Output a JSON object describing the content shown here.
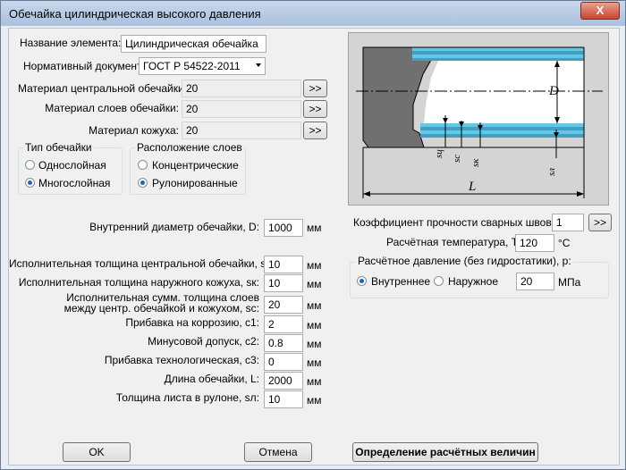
{
  "window": {
    "title": "Обечайка цилиндрическая высокого давления",
    "close_glyph": "X"
  },
  "element_name": {
    "label": "Название элемента:",
    "value": "Цилиндрическая обечайка"
  },
  "norm_doc": {
    "label": "Нормативный документ:",
    "value": "ГОСТ Р 54522-2011"
  },
  "materials": [
    {
      "label": "Материал центральной обечайки:",
      "value": "20",
      "button": ">>"
    },
    {
      "label": "Материал слоев обечайки:",
      "value": "20",
      "button": ">>"
    },
    {
      "label": "Материал кожуха:",
      "value": "20",
      "button": ">>"
    }
  ],
  "shell_type": {
    "title": "Тип обечайки",
    "options": [
      "Однослойная",
      "Многослойная"
    ],
    "selected": "Многослойная"
  },
  "layers_arrangement": {
    "title": "Расположение слоев",
    "options": [
      "Концентрические",
      "Рулонированные"
    ],
    "selected": "Рулонированные"
  },
  "inner_diameter": {
    "label": "Внутренний диаметр обечайки, D:",
    "value": "1000",
    "unit": "мм"
  },
  "params": [
    {
      "label": "Исполнительная толщина центральной обечайки, sц:",
      "value": "10",
      "unit": "мм"
    },
    {
      "label": "Исполнительная толщина наружного кожуха, sк:",
      "value": "10",
      "unit": "мм"
    },
    {
      "label_line1": "Исполнительная сумм. толщина слоев",
      "label_line2": "между центр. обечайкой и кожухом, sс:",
      "value": "20",
      "unit": "мм"
    },
    {
      "label": "Прибавка на коррозию, c1:",
      "value": "2",
      "unit": "мм"
    },
    {
      "label": "Минусовой допуск, c2:",
      "value": "0.8",
      "unit": "мм"
    },
    {
      "label": "Прибавка технологическая, c3:",
      "value": "0",
      "unit": "мм"
    },
    {
      "label": "Длина обечайки, L:",
      "value": "2000",
      "unit": "мм"
    },
    {
      "label": "Толщина листа в рулоне, sл:",
      "value": "10",
      "unit": "мм"
    }
  ],
  "weld": {
    "label": "Коэффициент прочности сварных швов, Fi:",
    "value": "1",
    "button": ">>"
  },
  "temperature": {
    "label": "Расчётная температура, T:",
    "value": "120",
    "unit": "°C"
  },
  "pressure": {
    "title": "Расчётное давление (без гидростатики), p:",
    "options": [
      "Внутреннее",
      "Наружное"
    ],
    "selected": "Внутреннее",
    "value": "20",
    "unit": "МПа"
  },
  "drawing_labels": {
    "D": "D",
    "L": "L",
    "s_c": "sц",
    "s_s": "sс",
    "s_k": "sк",
    "s_l": "sл"
  },
  "buttons": {
    "ok": "OK",
    "cancel": "Отмена",
    "compute": "Определение расчётных величин"
  }
}
